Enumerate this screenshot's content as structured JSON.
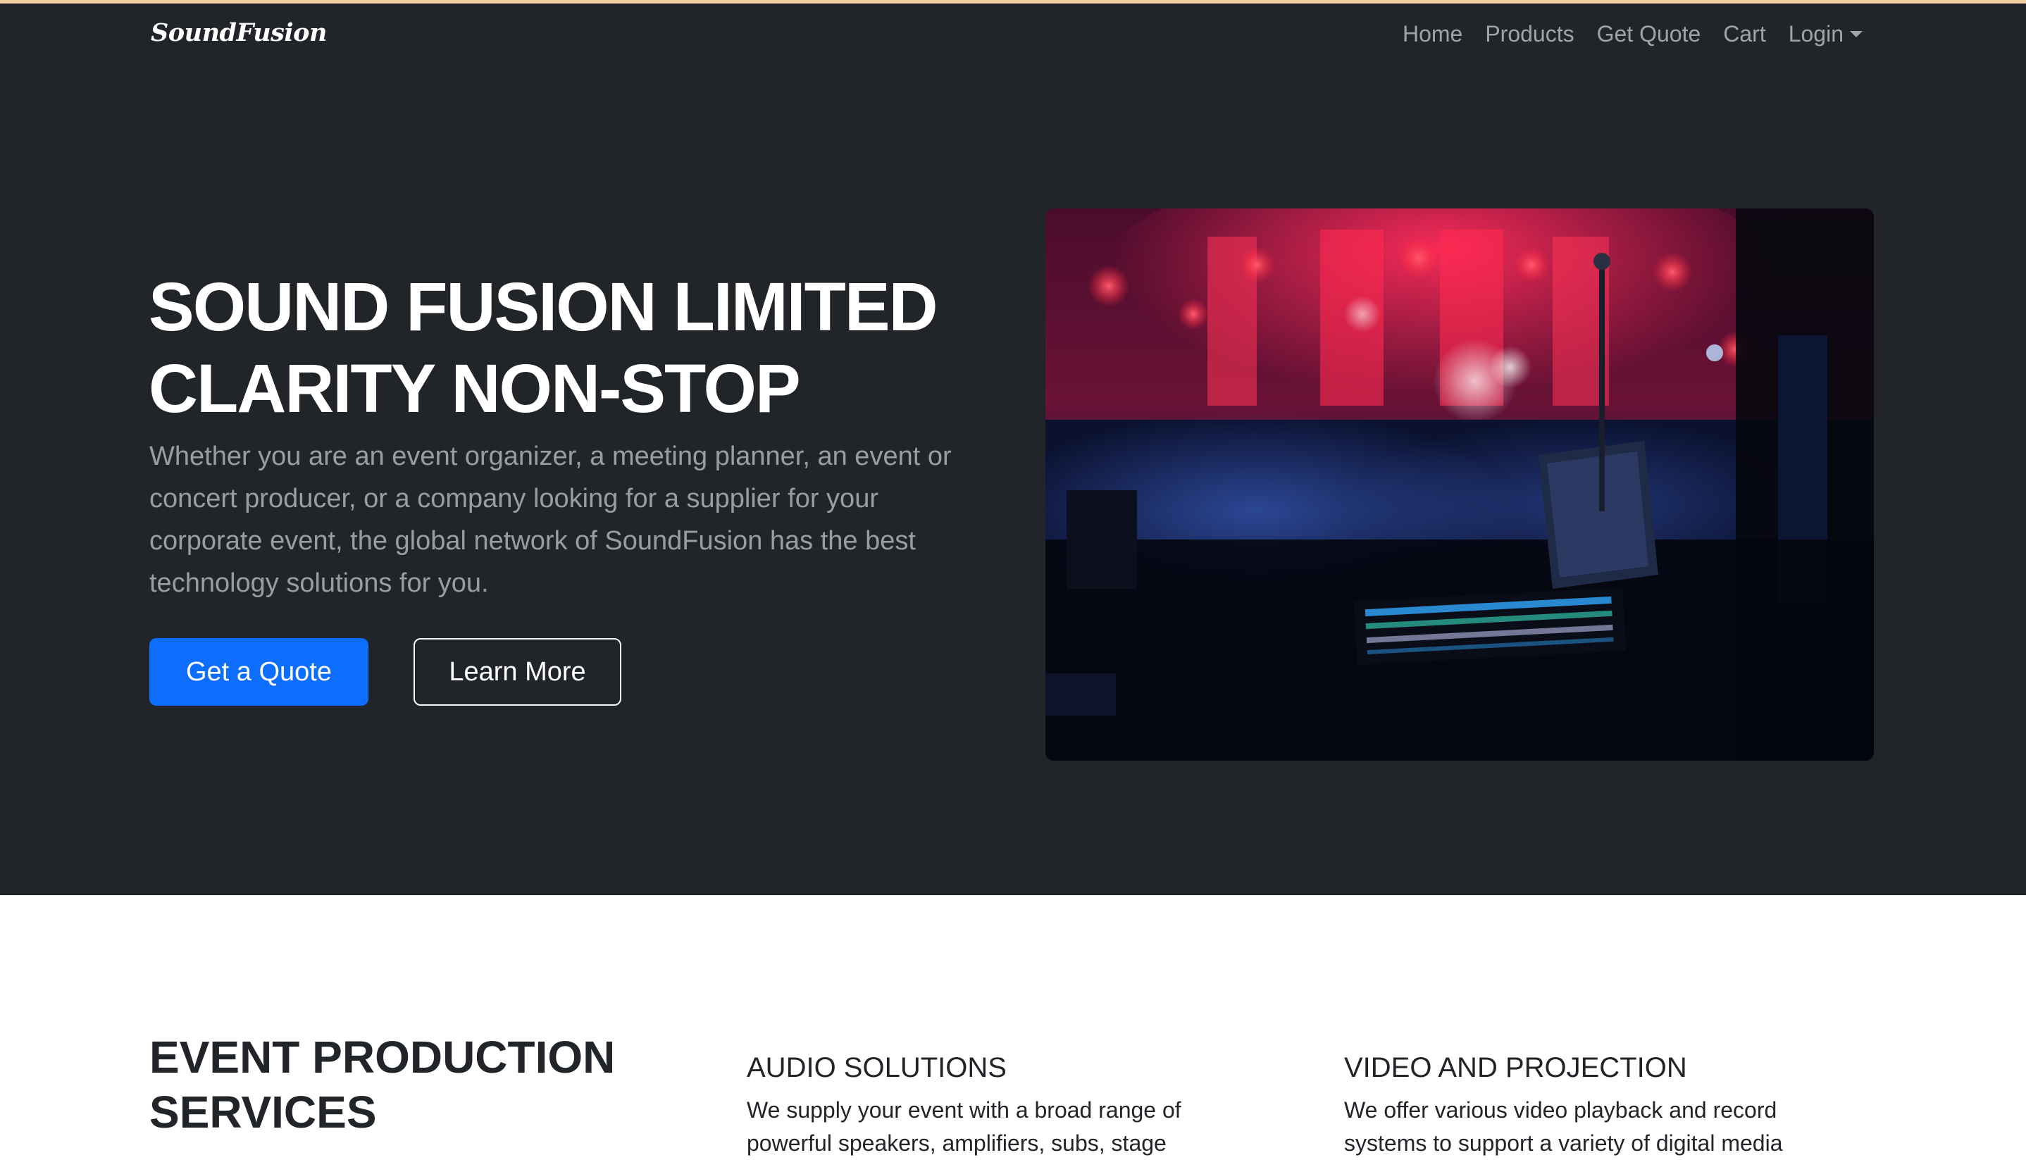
{
  "navbar": {
    "brand": "SoundFusion",
    "links": [
      "Home",
      "Products",
      "Get Quote",
      "Cart"
    ],
    "login_label": "Login"
  },
  "hero": {
    "title_line1": "SOUND FUSION LIMITED",
    "title_line2": "CLARITY NON-STOP",
    "description": "Whether you are an event organizer, a meeting planner, an event or concert producer, or a company looking for a supplier for your corporate event, the global network of SoundFusion has the best technology solutions for you.",
    "primary_button": "Get a Quote",
    "secondary_button": "Learn More"
  },
  "services": {
    "title_line1": "EVENT PRODUCTION",
    "title_line2": "SERVICES",
    "features": [
      {
        "title": "AUDIO SOLUTIONS",
        "text": "We supply your event with a broad range of powerful speakers, amplifiers, subs, stage"
      },
      {
        "title": "VIDEO AND PROJECTION",
        "text": "We offer various video playback and record systems to support a variety of digital media"
      }
    ]
  },
  "colors": {
    "dark_background": "#212529",
    "primary_blue": "#0d6efd",
    "top_accent": "#f3cfa4"
  }
}
